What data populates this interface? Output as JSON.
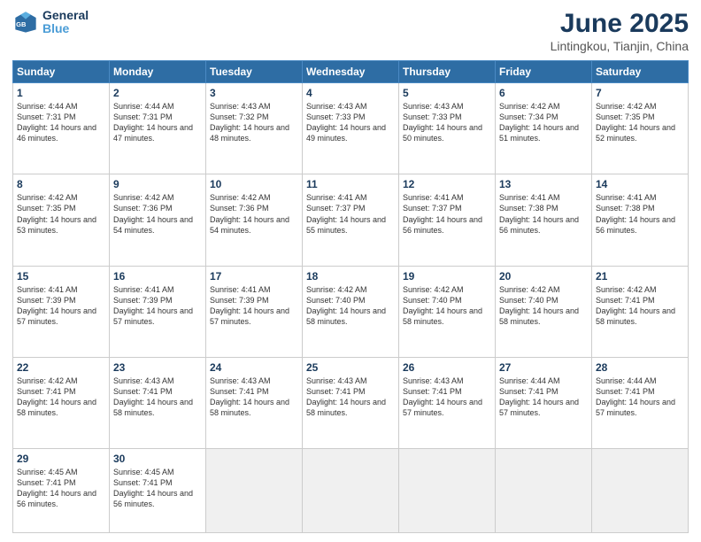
{
  "header": {
    "logo_line1": "General",
    "logo_line2": "Blue",
    "title": "June 2025",
    "subtitle": "Lintingkou, Tianjin, China"
  },
  "weekdays": [
    "Sunday",
    "Monday",
    "Tuesday",
    "Wednesday",
    "Thursday",
    "Friday",
    "Saturday"
  ],
  "weeks": [
    [
      {
        "num": "1",
        "sunrise": "4:44 AM",
        "sunset": "7:31 PM",
        "daylight": "14 hours and 46 minutes."
      },
      {
        "num": "2",
        "sunrise": "4:44 AM",
        "sunset": "7:31 PM",
        "daylight": "14 hours and 47 minutes."
      },
      {
        "num": "3",
        "sunrise": "4:43 AM",
        "sunset": "7:32 PM",
        "daylight": "14 hours and 48 minutes."
      },
      {
        "num": "4",
        "sunrise": "4:43 AM",
        "sunset": "7:33 PM",
        "daylight": "14 hours and 49 minutes."
      },
      {
        "num": "5",
        "sunrise": "4:43 AM",
        "sunset": "7:33 PM",
        "daylight": "14 hours and 50 minutes."
      },
      {
        "num": "6",
        "sunrise": "4:42 AM",
        "sunset": "7:34 PM",
        "daylight": "14 hours and 51 minutes."
      },
      {
        "num": "7",
        "sunrise": "4:42 AM",
        "sunset": "7:35 PM",
        "daylight": "14 hours and 52 minutes."
      }
    ],
    [
      {
        "num": "8",
        "sunrise": "4:42 AM",
        "sunset": "7:35 PM",
        "daylight": "14 hours and 53 minutes."
      },
      {
        "num": "9",
        "sunrise": "4:42 AM",
        "sunset": "7:36 PM",
        "daylight": "14 hours and 54 minutes."
      },
      {
        "num": "10",
        "sunrise": "4:42 AM",
        "sunset": "7:36 PM",
        "daylight": "14 hours and 54 minutes."
      },
      {
        "num": "11",
        "sunrise": "4:41 AM",
        "sunset": "7:37 PM",
        "daylight": "14 hours and 55 minutes."
      },
      {
        "num": "12",
        "sunrise": "4:41 AM",
        "sunset": "7:37 PM",
        "daylight": "14 hours and 56 minutes."
      },
      {
        "num": "13",
        "sunrise": "4:41 AM",
        "sunset": "7:38 PM",
        "daylight": "14 hours and 56 minutes."
      },
      {
        "num": "14",
        "sunrise": "4:41 AM",
        "sunset": "7:38 PM",
        "daylight": "14 hours and 56 minutes."
      }
    ],
    [
      {
        "num": "15",
        "sunrise": "4:41 AM",
        "sunset": "7:39 PM",
        "daylight": "14 hours and 57 minutes."
      },
      {
        "num": "16",
        "sunrise": "4:41 AM",
        "sunset": "7:39 PM",
        "daylight": "14 hours and 57 minutes."
      },
      {
        "num": "17",
        "sunrise": "4:41 AM",
        "sunset": "7:39 PM",
        "daylight": "14 hours and 57 minutes."
      },
      {
        "num": "18",
        "sunrise": "4:42 AM",
        "sunset": "7:40 PM",
        "daylight": "14 hours and 58 minutes."
      },
      {
        "num": "19",
        "sunrise": "4:42 AM",
        "sunset": "7:40 PM",
        "daylight": "14 hours and 58 minutes."
      },
      {
        "num": "20",
        "sunrise": "4:42 AM",
        "sunset": "7:40 PM",
        "daylight": "14 hours and 58 minutes."
      },
      {
        "num": "21",
        "sunrise": "4:42 AM",
        "sunset": "7:41 PM",
        "daylight": "14 hours and 58 minutes."
      }
    ],
    [
      {
        "num": "22",
        "sunrise": "4:42 AM",
        "sunset": "7:41 PM",
        "daylight": "14 hours and 58 minutes."
      },
      {
        "num": "23",
        "sunrise": "4:43 AM",
        "sunset": "7:41 PM",
        "daylight": "14 hours and 58 minutes."
      },
      {
        "num": "24",
        "sunrise": "4:43 AM",
        "sunset": "7:41 PM",
        "daylight": "14 hours and 58 minutes."
      },
      {
        "num": "25",
        "sunrise": "4:43 AM",
        "sunset": "7:41 PM",
        "daylight": "14 hours and 58 minutes."
      },
      {
        "num": "26",
        "sunrise": "4:43 AM",
        "sunset": "7:41 PM",
        "daylight": "14 hours and 57 minutes."
      },
      {
        "num": "27",
        "sunrise": "4:44 AM",
        "sunset": "7:41 PM",
        "daylight": "14 hours and 57 minutes."
      },
      {
        "num": "28",
        "sunrise": "4:44 AM",
        "sunset": "7:41 PM",
        "daylight": "14 hours and 57 minutes."
      }
    ],
    [
      {
        "num": "29",
        "sunrise": "4:45 AM",
        "sunset": "7:41 PM",
        "daylight": "14 hours and 56 minutes."
      },
      {
        "num": "30",
        "sunrise": "4:45 AM",
        "sunset": "7:41 PM",
        "daylight": "14 hours and 56 minutes."
      },
      null,
      null,
      null,
      null,
      null
    ]
  ]
}
